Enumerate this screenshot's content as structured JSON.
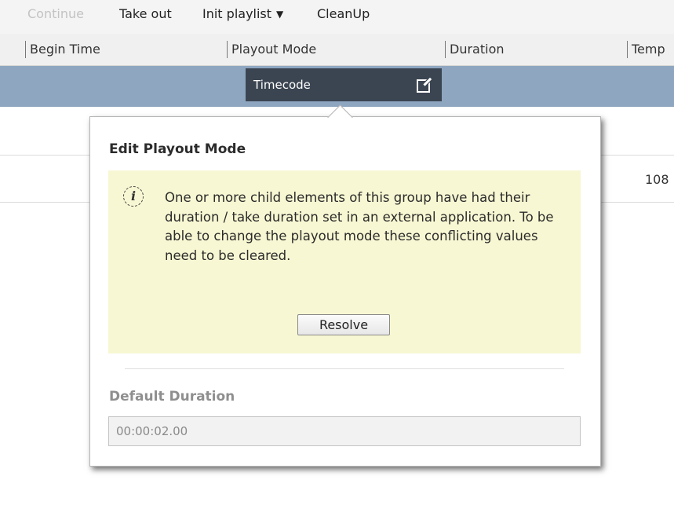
{
  "toolbar": {
    "continue_label": "Continue",
    "take_out_label": "Take out",
    "init_playlist_label": "Init playlist",
    "cleanup_label": "CleanUp"
  },
  "columns": [
    "Begin Time",
    "Playout Mode",
    "Duration",
    "Temp"
  ],
  "selected_row": {
    "playout_mode_value": "Timecode"
  },
  "rows": {
    "second_row_value": "108"
  },
  "popup": {
    "title": "Edit Playout Mode",
    "info": {
      "message": "One or more child elements of this group have had their duration / take duration set in an external application. To be able to change the playout mode these conflicting values need to be cleared.",
      "resolve_label": "Resolve"
    },
    "default_duration": {
      "label": "Default Duration",
      "value": "00:00:02.00"
    }
  },
  "icons": {
    "dropdown_caret": "caret-down-icon",
    "edit": "edit-icon",
    "info": "info-icon"
  },
  "colors": {
    "selected_row": "#8ea6c0",
    "dropdown_bg": "#3b4552",
    "info_box_bg": "#f7f7d3"
  }
}
